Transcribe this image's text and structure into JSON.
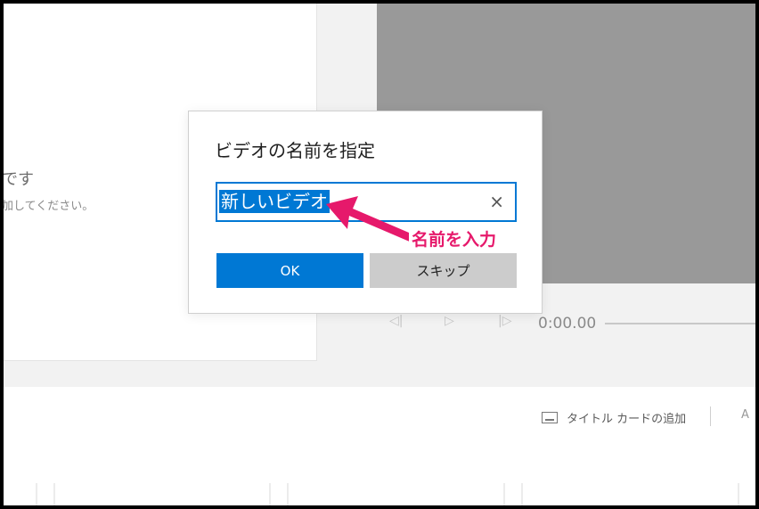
{
  "library": {
    "title_fragment": "です",
    "subtitle_fragment": "加してください。"
  },
  "player": {
    "prev_icon": "step-back-icon",
    "play_icon": "play-icon",
    "next_icon": "step-forward-icon",
    "time": "0:00.00"
  },
  "storyboard": {
    "title_card_label": "タイトル カードの追加"
  },
  "dialog": {
    "title": "ビデオの名前を指定",
    "name_value": "新しいビデオ",
    "ok_label": "OK",
    "skip_label": "スキップ"
  },
  "annotation": {
    "label": "名前を入力",
    "color": "#e6196b"
  },
  "colors": {
    "accent": "#0078d4",
    "preview_bg": "#999999"
  }
}
